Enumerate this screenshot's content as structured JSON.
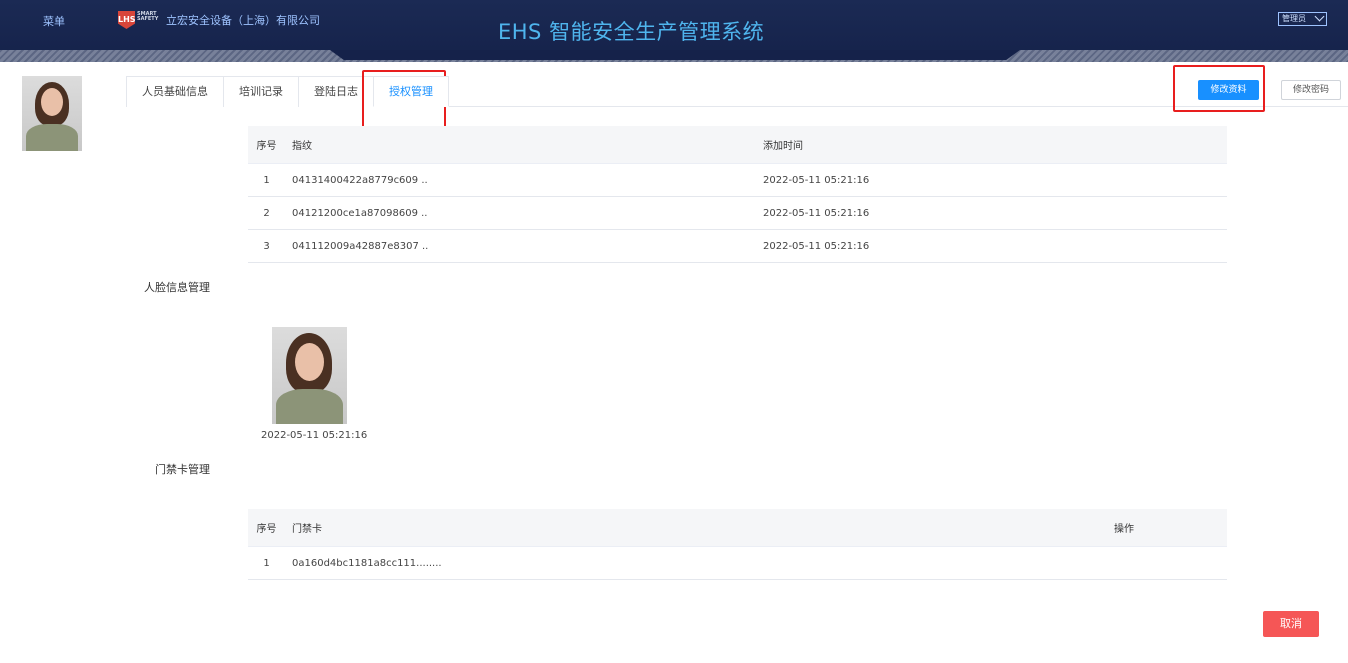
{
  "header": {
    "menu_label": "菜单",
    "logo_mark": "LHS",
    "logo_small": "SMART SAFETY",
    "company": "立宏安全设备（上海）有限公司",
    "app_title": "EHS 智能安全生产管理系统",
    "user_role": "管理员"
  },
  "tabs": [
    {
      "label": "人员基础信息",
      "active": false
    },
    {
      "label": "培训记录",
      "active": false
    },
    {
      "label": "登陆日志",
      "active": false
    },
    {
      "label": "授权管理",
      "active": true
    }
  ],
  "actions": {
    "edit_profile": "修改资料",
    "change_password": "修改密码",
    "cancel": "取消"
  },
  "fingerprint_table": {
    "columns": {
      "index": "序号",
      "fingerprint": "指纹",
      "added_time": "添加时间"
    },
    "rows": [
      {
        "index": "1",
        "fingerprint": "04131400422a8779c609 ..",
        "added_time": "2022-05-11 05:21:16"
      },
      {
        "index": "2",
        "fingerprint": "04121200ce1a87098609 ..",
        "added_time": "2022-05-11 05:21:16"
      },
      {
        "index": "3",
        "fingerprint": "041112009a42887e8307 ..",
        "added_time": "2022-05-11 05:21:16"
      }
    ]
  },
  "face_section": {
    "label": "人脸信息管理",
    "photo_time": "2022-05-11 05:21:16"
  },
  "card_section": {
    "label": "门禁卡管理",
    "columns": {
      "index": "序号",
      "card": "门禁卡",
      "operation": "操作"
    },
    "rows": [
      {
        "index": "1",
        "card": "0a160d4bc1181a8cc111........",
        "operation": ""
      }
    ]
  },
  "colors": {
    "header_bg": "#15224a",
    "primary": "#1890ff",
    "danger": "#f55656",
    "highlight": "#e81e1e"
  }
}
